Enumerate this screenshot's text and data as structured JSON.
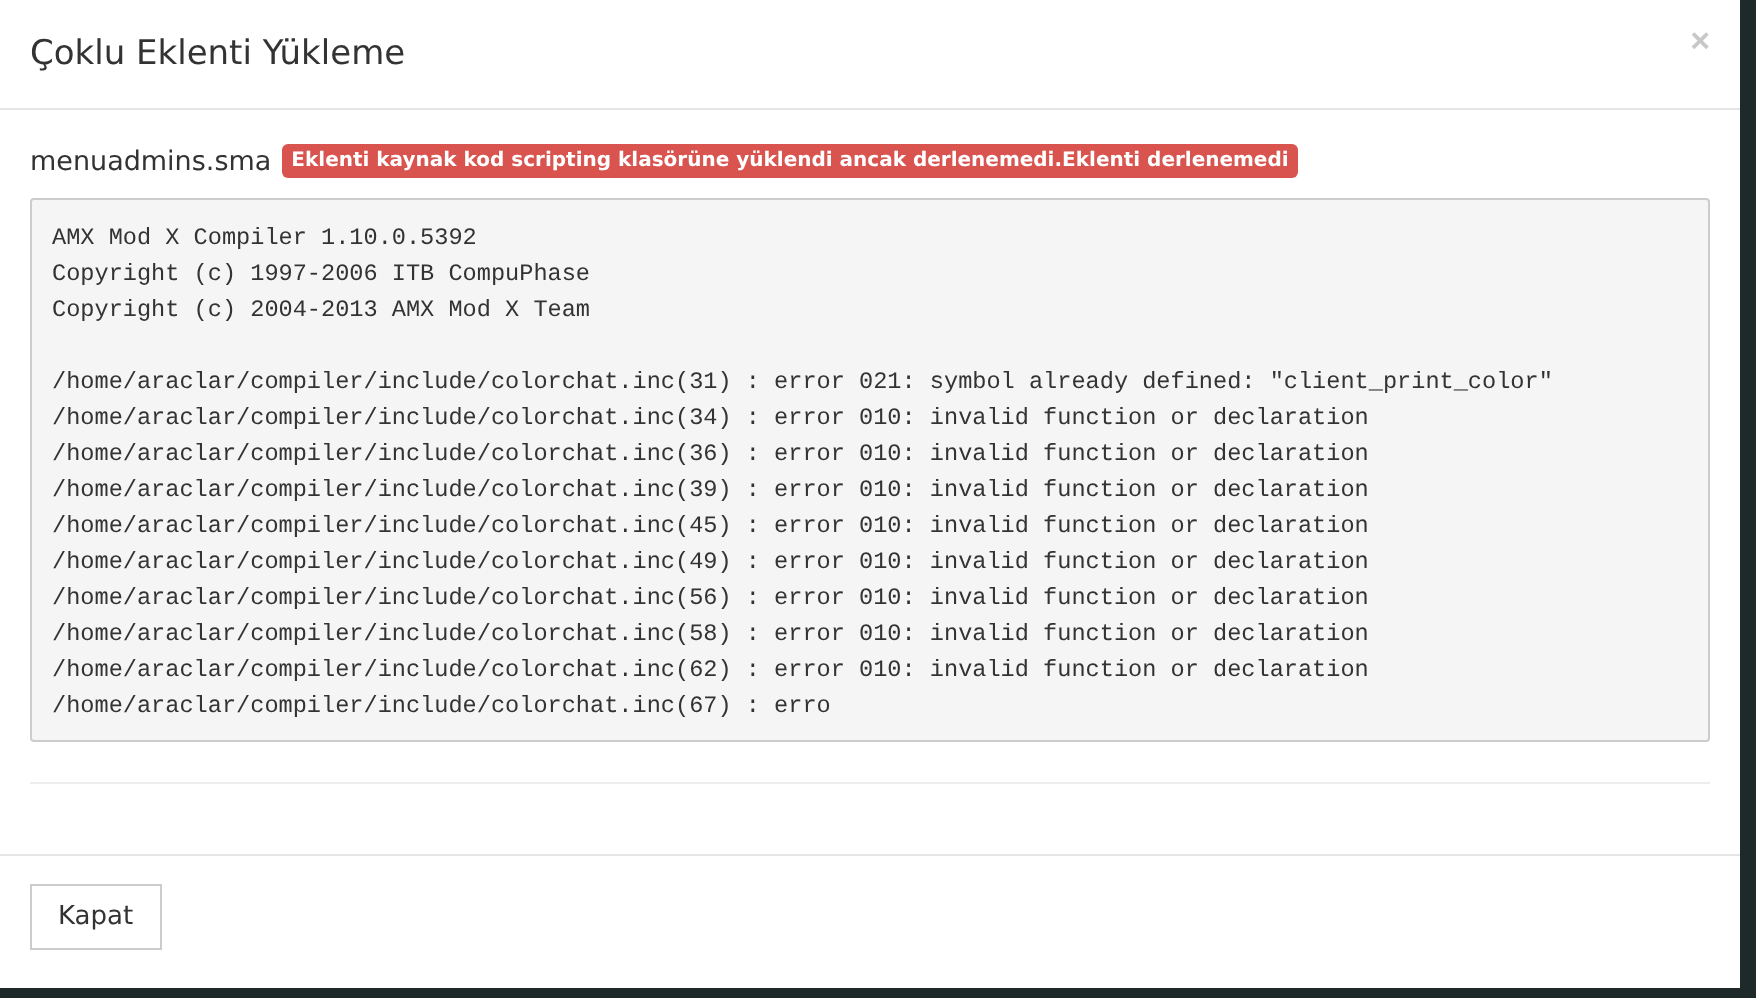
{
  "modal": {
    "title": "Çoklu Eklenti Yükleme",
    "close": "×"
  },
  "file": {
    "name": "menuadmins.sma",
    "status_label": "Eklenti kaynak kod scripting klasörüne yüklendi ancak derlenemedi.Eklenti derlenemedi"
  },
  "log_header": [
    "AMX Mod X Compiler 1.10.0.5392",
    "Copyright (c) 1997-2006 ITB CompuPhase",
    "Copyright (c) 2004-2013 AMX Mod X Team"
  ],
  "log_errors": [
    "/home/araclar/compiler/include/colorchat.inc(31) : error 021: symbol already defined: \"client_print_color\"",
    "/home/araclar/compiler/include/colorchat.inc(34) : error 010: invalid function or declaration",
    "/home/araclar/compiler/include/colorchat.inc(36) : error 010: invalid function or declaration",
    "/home/araclar/compiler/include/colorchat.inc(39) : error 010: invalid function or declaration",
    "/home/araclar/compiler/include/colorchat.inc(45) : error 010: invalid function or declaration",
    "/home/araclar/compiler/include/colorchat.inc(49) : error 010: invalid function or declaration",
    "/home/araclar/compiler/include/colorchat.inc(56) : error 010: invalid function or declaration",
    "/home/araclar/compiler/include/colorchat.inc(58) : error 010: invalid function or declaration",
    "/home/araclar/compiler/include/colorchat.inc(62) : error 010: invalid function or declaration",
    "/home/araclar/compiler/include/colorchat.inc(67) : erro"
  ],
  "buttons": [
    "Kapat"
  ]
}
